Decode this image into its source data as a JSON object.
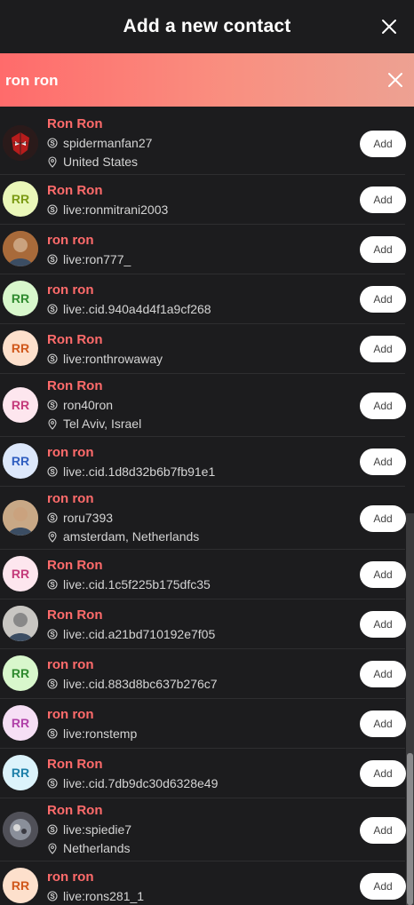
{
  "header": {
    "title": "Add a new contact"
  },
  "search": {
    "value": "ron ron"
  },
  "add_label": "Add",
  "contacts": [
    {
      "name": "Ron Ron",
      "id": "spidermanfan27",
      "location": "United States",
      "initials": "",
      "avatar_bg": "#3a2020",
      "initials_color": ""
    },
    {
      "name": "Ron Ron",
      "id": "live:ronmitrani2003",
      "location": "",
      "initials": "RR",
      "avatar_bg": "#eaf7b9",
      "initials_color": "#7b9a14"
    },
    {
      "name": "ron ron",
      "id": "live:ron777_",
      "location": "",
      "initials": "",
      "avatar_bg": "#a86a3a",
      "initials_color": ""
    },
    {
      "name": "ron ron",
      "id": "live:.cid.940a4d4f1a9cf268",
      "location": "",
      "initials": "RR",
      "avatar_bg": "#d8f7cc",
      "initials_color": "#2e8a2e"
    },
    {
      "name": "Ron Ron",
      "id": "live:ronthrowaway",
      "location": "",
      "initials": "RR",
      "avatar_bg": "#fde0cc",
      "initials_color": "#d0571a"
    },
    {
      "name": "Ron Ron",
      "id": "ron40ron",
      "location": "Tel Aviv, Israel",
      "initials": "RR",
      "avatar_bg": "#fde6ee",
      "initials_color": "#c43a7a"
    },
    {
      "name": "ron ron",
      "id": "live:.cid.1d8d32b6b7fb91e1",
      "location": "",
      "initials": "RR",
      "avatar_bg": "#dde8fb",
      "initials_color": "#2f5ec0"
    },
    {
      "name": "ron ron",
      "id": "roru7393",
      "location": "amsterdam, Netherlands",
      "initials": "",
      "avatar_bg": "#c8a886",
      "initials_color": ""
    },
    {
      "name": "Ron Ron",
      "id": "live:.cid.1c5f225b175dfc35",
      "location": "",
      "initials": "RR",
      "avatar_bg": "#fde6ee",
      "initials_color": "#c43a7a"
    },
    {
      "name": "Ron Ron",
      "id": "live:.cid.a21bd710192e7f05",
      "location": "",
      "initials": "",
      "avatar_bg": "#c8c6c2",
      "initials_color": ""
    },
    {
      "name": "ron ron",
      "id": "live:.cid.883d8bc637b276c7",
      "location": "",
      "initials": "RR",
      "avatar_bg": "#d8f7cc",
      "initials_color": "#2e8a2e"
    },
    {
      "name": "ron ron",
      "id": "live:ronstemp",
      "location": "",
      "initials": "RR",
      "avatar_bg": "#f6dff5",
      "initials_color": "#b040a8"
    },
    {
      "name": "Ron Ron",
      "id": "live:.cid.7db9dc30d6328e49",
      "location": "",
      "initials": "RR",
      "avatar_bg": "#dcf3fb",
      "initials_color": "#1c7fa8"
    },
    {
      "name": "Ron Ron",
      "id": "live:spiedie7",
      "location": "Netherlands",
      "initials": "",
      "avatar_bg": "#6a6a70",
      "initials_color": ""
    },
    {
      "name": "ron ron",
      "id": "live:rons281_1",
      "location": "",
      "initials": "RR",
      "avatar_bg": "#fde0cc",
      "initials_color": "#d0571a"
    }
  ]
}
